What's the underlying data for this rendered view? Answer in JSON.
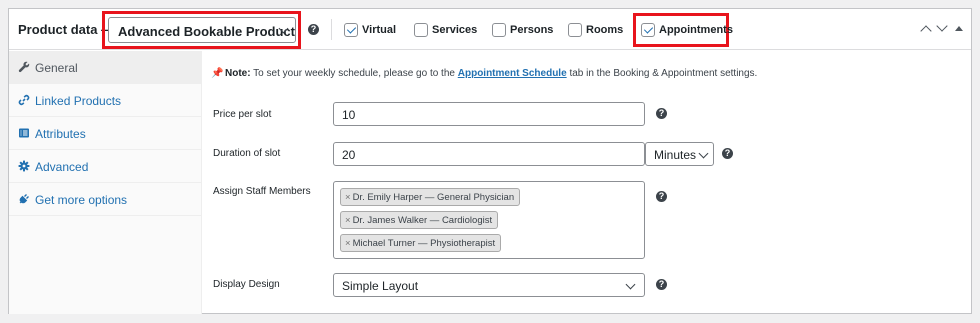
{
  "header": {
    "title": "Product data —",
    "product_type": "Advanced Bookable Product",
    "options": [
      {
        "label": "Virtual",
        "checked": true
      },
      {
        "label": "Services",
        "checked": false
      },
      {
        "label": "Persons",
        "checked": false
      },
      {
        "label": "Rooms",
        "checked": false
      },
      {
        "label": "Appointments",
        "checked": true
      }
    ]
  },
  "sidebar": {
    "items": [
      {
        "label": "General",
        "icon": "wrench-icon",
        "active": true
      },
      {
        "label": "Linked Products",
        "icon": "link-icon",
        "active": false
      },
      {
        "label": "Attributes",
        "icon": "list-icon",
        "active": false
      },
      {
        "label": "Advanced",
        "icon": "gear-icon",
        "active": false
      },
      {
        "label": "Get more options",
        "icon": "plugin-icon",
        "active": false
      }
    ]
  },
  "note": {
    "prefix": "Note:",
    "text_before": "To set your weekly schedule, please go to the",
    "link": "Appointment Schedule",
    "text_after": "tab in the Booking & Appointment settings."
  },
  "fields": {
    "price_label": "Price per slot",
    "price_value": "10",
    "duration_label": "Duration of slot",
    "duration_value": "20",
    "duration_unit": "Minutes",
    "staff_label": "Assign Staff Members",
    "staff": [
      "Dr. Emily Harper — General Physician",
      "Dr. James Walker — Cardiologist",
      "Michael Turner — Physiotherapist"
    ],
    "design_label": "Display Design",
    "design_value": "Simple Layout"
  },
  "colors": {
    "accent": "#2271b1",
    "highlight": "#e8141c",
    "text": "#1d2327"
  }
}
